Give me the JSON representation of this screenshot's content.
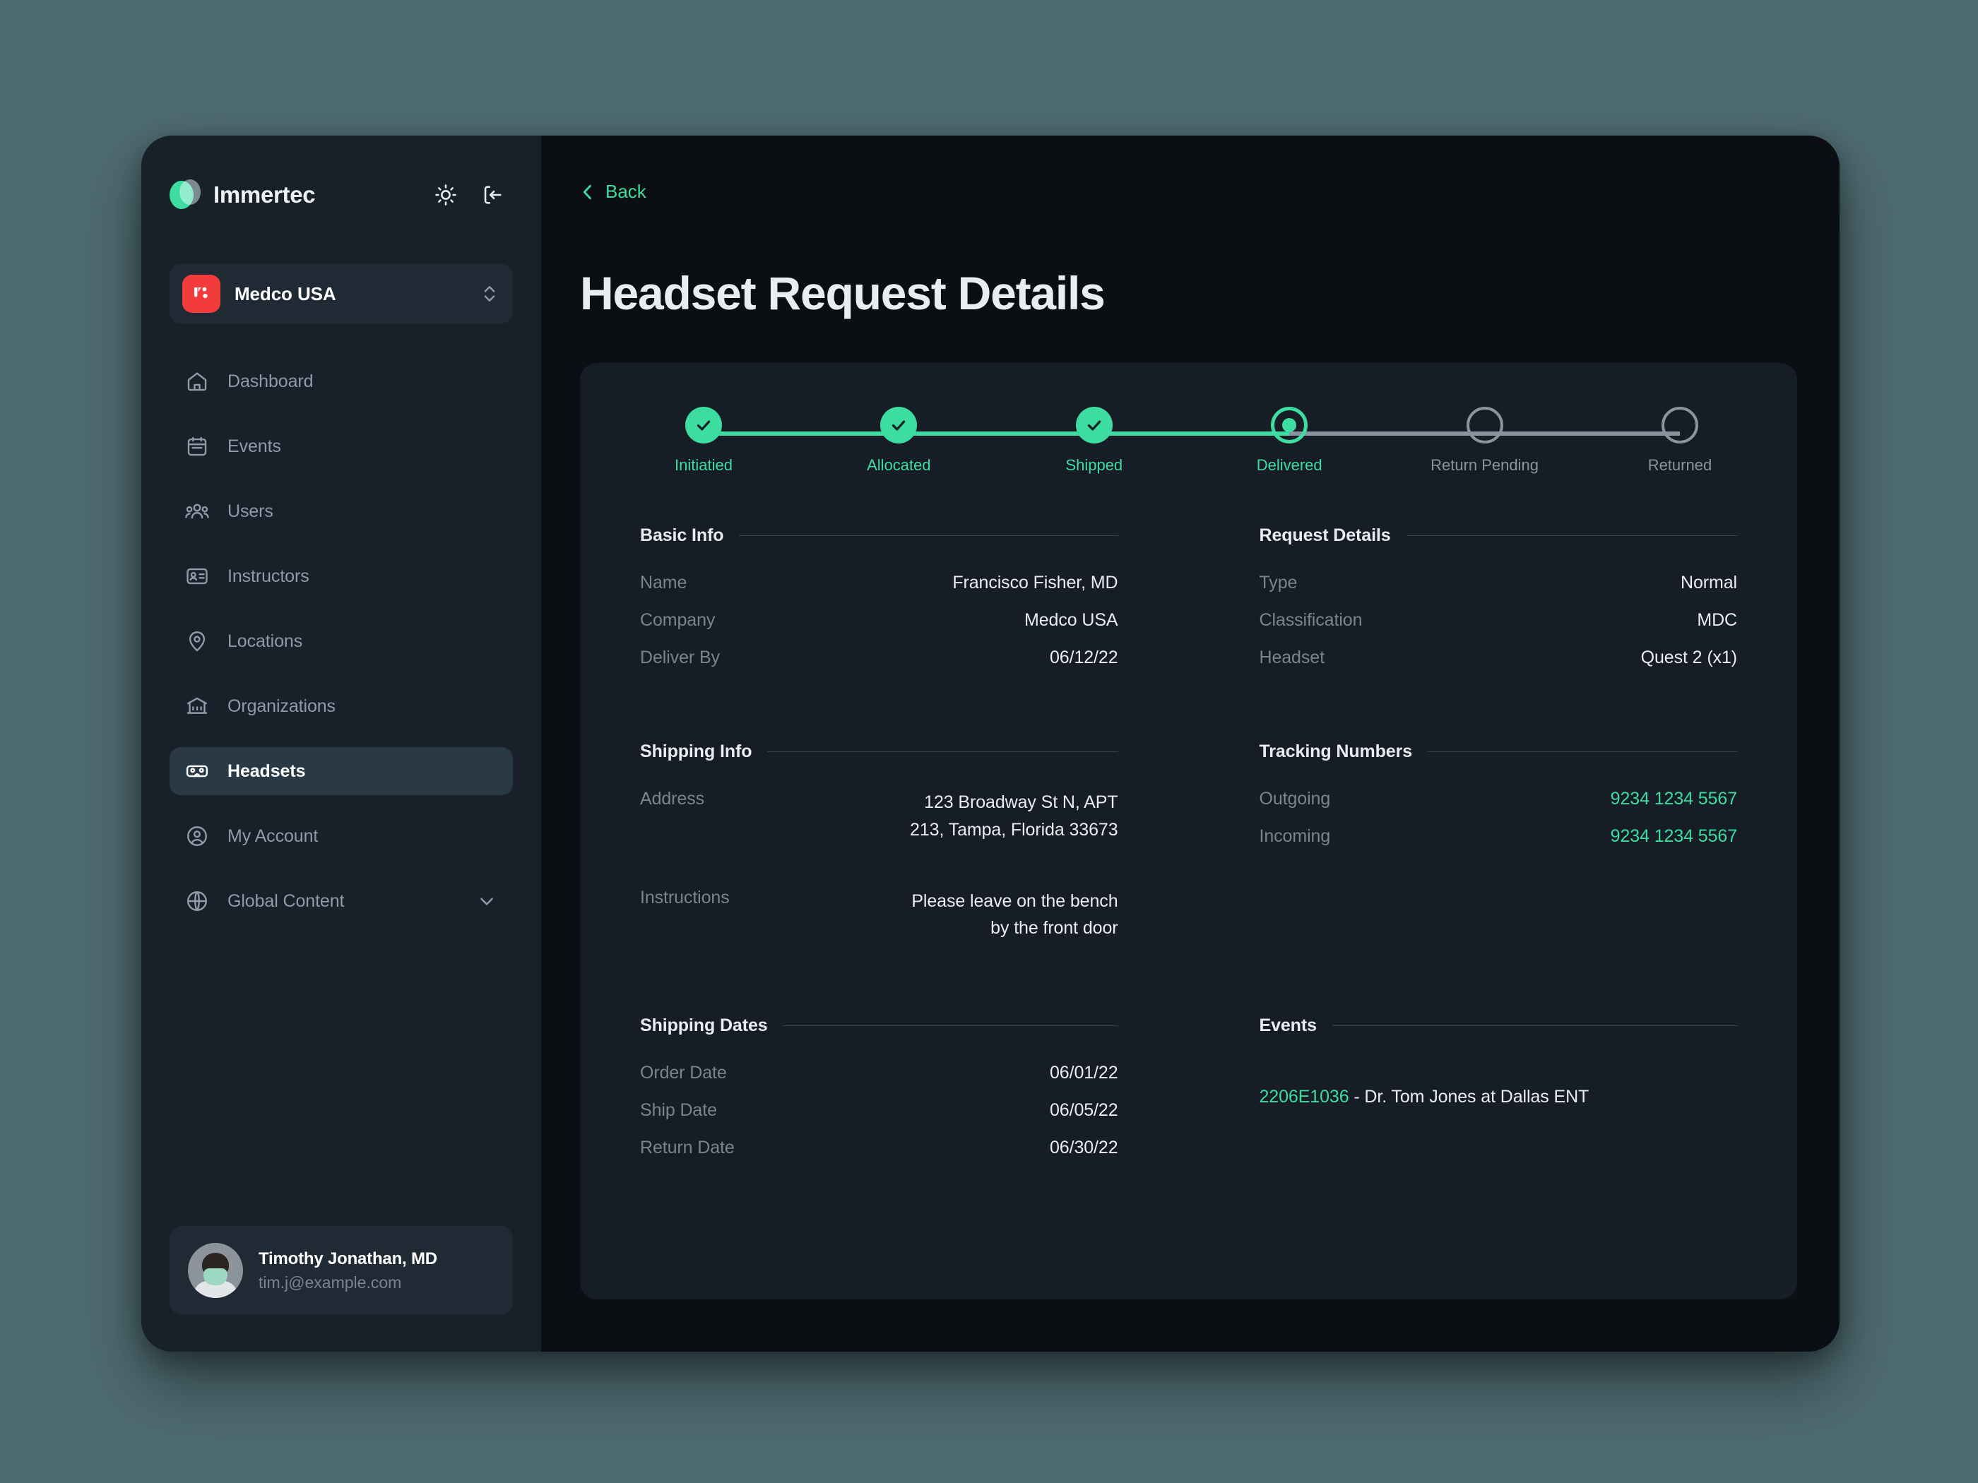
{
  "theme": {
    "page_bg": "#4e6b71",
    "app_bg": "#0b0f14",
    "sidebar_bg": "#18202a",
    "card_bg": "#161d26",
    "accent_green": "#3ddca0",
    "org_red": "#f43b3b",
    "muted_text": "#78858f",
    "primary_text": "#e9edf2",
    "inactive_step": "#8b949e"
  },
  "sidebar": {
    "brand": {
      "name": "Immertec",
      "logo_icon": "immertec-logo-icon"
    },
    "header_actions": [
      {
        "icon": "sun-icon",
        "name": "theme-toggle-button"
      },
      {
        "icon": "logout-icon",
        "name": "logout-button"
      }
    ],
    "org_switcher": {
      "name": "Medco USA",
      "avatar_icon": "medco-avatar-icon",
      "chevron_icon": "chevron-up-down-icon"
    },
    "items": [
      {
        "label": "Dashboard",
        "icon": "home-icon",
        "active": false,
        "expandable": false
      },
      {
        "label": "Events",
        "icon": "calendar-icon",
        "active": false,
        "expandable": false
      },
      {
        "label": "Users",
        "icon": "users-icon",
        "active": false,
        "expandable": false
      },
      {
        "label": "Instructors",
        "icon": "id-badge-icon",
        "active": false,
        "expandable": false
      },
      {
        "label": "Locations",
        "icon": "map-pin-icon",
        "active": false,
        "expandable": false
      },
      {
        "label": "Organizations",
        "icon": "bank-icon",
        "active": false,
        "expandable": false
      },
      {
        "label": "Headsets",
        "icon": "vr-headset-icon",
        "active": true,
        "expandable": false
      },
      {
        "label": "My Account",
        "icon": "user-circle-icon",
        "active": false,
        "expandable": false
      },
      {
        "label": "Global Content",
        "icon": "globe-icon",
        "active": false,
        "expandable": true
      }
    ],
    "user": {
      "name": "Timothy Jonathan, MD",
      "email": "tim.j@example.com",
      "avatar_icon": "user-photo-avatar"
    }
  },
  "main": {
    "back_label": "Back",
    "back_icon": "chevron-left-icon",
    "page_title": "Headset Request Details",
    "stepper": {
      "steps": [
        {
          "label": "Initiatied",
          "state": "done"
        },
        {
          "label": "Allocated",
          "state": "done"
        },
        {
          "label": "Shipped",
          "state": "done"
        },
        {
          "label": "Delivered",
          "state": "current"
        },
        {
          "label": "Return Pending",
          "state": "todo"
        },
        {
          "label": "Returned",
          "state": "todo"
        }
      ]
    },
    "sections": {
      "basic_info": {
        "title": "Basic Info",
        "fields": [
          {
            "label": "Name",
            "value": "Francisco Fisher, MD"
          },
          {
            "label": "Company",
            "value": "Medco USA"
          },
          {
            "label": "Deliver By",
            "value": "06/12/22"
          }
        ]
      },
      "request_details": {
        "title": "Request Details",
        "fields": [
          {
            "label": "Type",
            "value": "Normal"
          },
          {
            "label": "Classification",
            "value": "MDC"
          },
          {
            "label": "Headset",
            "value": "Quest 2 (x1)"
          }
        ]
      },
      "shipping_info": {
        "title": "Shipping Info",
        "address_label": "Address",
        "address_line1": "123 Broadway St N, APT",
        "address_line2": "213, Tampa, Florida 33673",
        "instructions_label": "Instructions",
        "instructions_line1": "Please leave on the bench",
        "instructions_line2": "by the front door"
      },
      "tracking_numbers": {
        "title": "Tracking Numbers",
        "fields": [
          {
            "label": "Outgoing",
            "value": "9234 1234 5567"
          },
          {
            "label": "Incoming",
            "value": "9234 1234 5567"
          }
        ]
      },
      "shipping_dates": {
        "title": "Shipping Dates",
        "fields": [
          {
            "label": "Order Date",
            "value": "06/01/22"
          },
          {
            "label": "Ship Date",
            "value": "06/05/22"
          },
          {
            "label": "Return Date",
            "value": "06/30/22"
          }
        ]
      },
      "events": {
        "title": "Events",
        "items": [
          {
            "id": "2206E1036",
            "description": " - Dr. Tom Jones at Dallas ENT"
          }
        ]
      }
    }
  }
}
